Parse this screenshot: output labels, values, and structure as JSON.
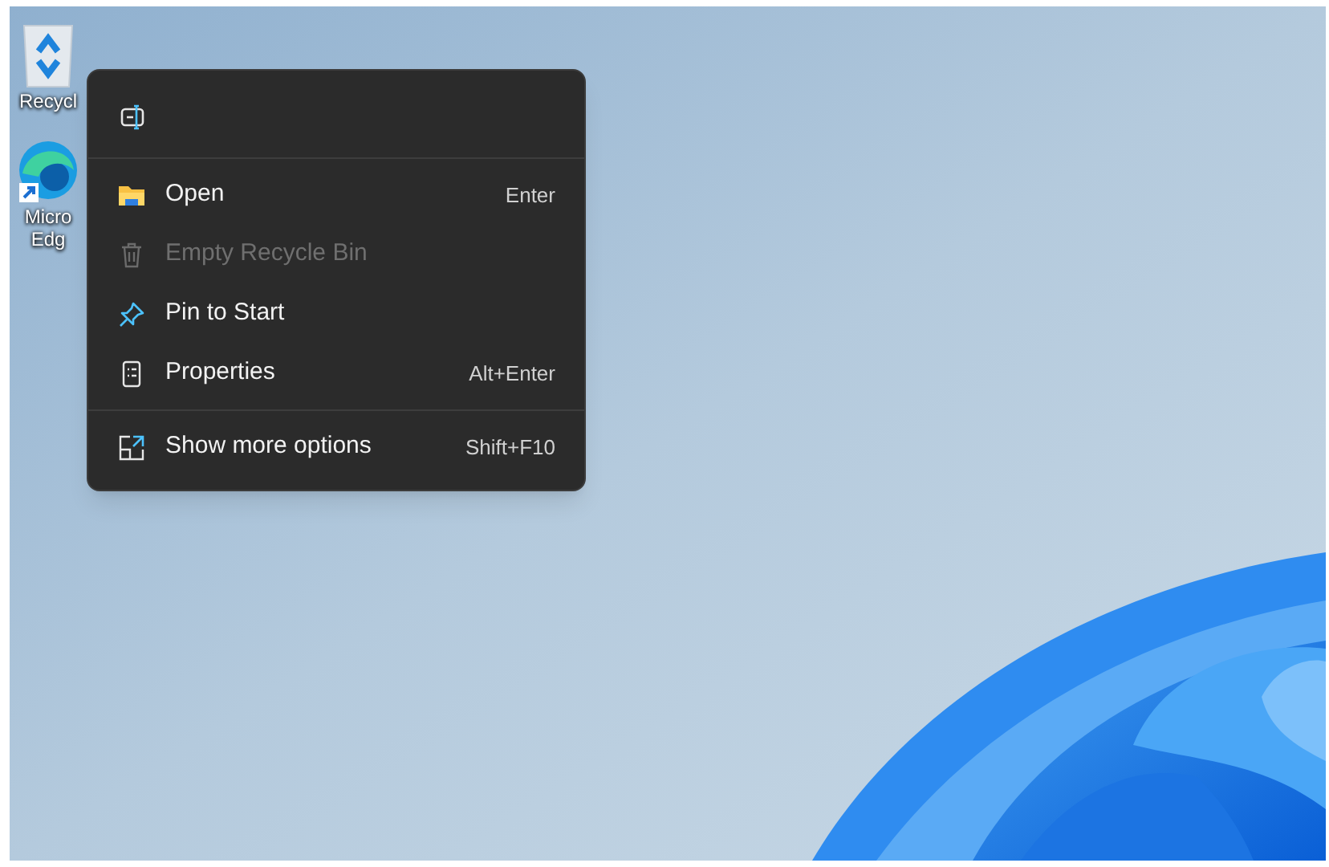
{
  "desktop_icons": [
    {
      "kind": "recycle-bin",
      "lines": [
        "Recycl"
      ]
    },
    {
      "kind": "edge",
      "lines": [
        "Micro",
        "Edg"
      ]
    }
  ],
  "context_menu": {
    "toolbar": [
      {
        "kind": "rename"
      }
    ],
    "groups": [
      [
        {
          "kind": "open",
          "label": "Open",
          "shortcut": "Enter",
          "disabled": false
        },
        {
          "kind": "empty",
          "label": "Empty Recycle Bin",
          "disabled": true
        },
        {
          "kind": "pin",
          "label": "Pin to Start",
          "disabled": false
        },
        {
          "kind": "properties",
          "label": "Properties",
          "shortcut": "Alt+Enter",
          "disabled": false
        }
      ],
      [
        {
          "kind": "more",
          "label": "Show more options",
          "shortcut": "Shift+F10",
          "disabled": false
        }
      ]
    ]
  }
}
